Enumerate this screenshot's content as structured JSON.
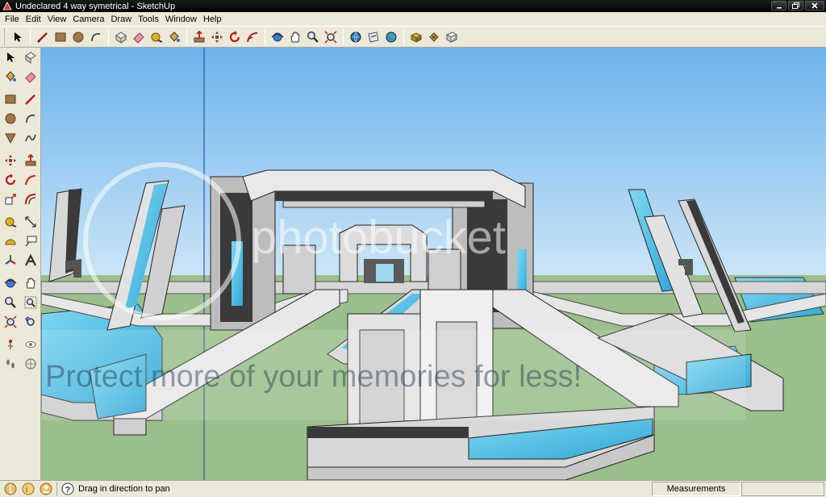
{
  "window": {
    "title": "Undeclared 4 way symetrical - SketchUp"
  },
  "menu": {
    "items": [
      {
        "label": "File"
      },
      {
        "label": "Edit"
      },
      {
        "label": "View"
      },
      {
        "label": "Camera"
      },
      {
        "label": "Draw"
      },
      {
        "label": "Tools"
      },
      {
        "label": "Window"
      },
      {
        "label": "Help"
      }
    ]
  },
  "toolbar_top": {
    "tools": [
      "select-icon",
      "line-icon",
      "rectangle-icon",
      "circle-icon",
      "arc-icon",
      "make-component-icon",
      "eraser-icon",
      "tape-measure-icon",
      "paint-bucket-icon",
      "push-pull-icon",
      "move-icon",
      "rotate-icon",
      "follow-me-icon",
      "orbit-icon",
      "pan-icon",
      "zoom-icon",
      "zoom-extents-icon",
      "get-models-icon",
      "share-model-icon",
      "google-earth-icon",
      "components-icon",
      "materials-icon",
      "styles-icon"
    ]
  },
  "toolbar_left": {
    "tools": [
      "select-icon",
      "make-component-icon",
      "paint-bucket-icon",
      "eraser-icon",
      "rectangle-icon",
      "line-icon",
      "circle-icon",
      "arc-icon",
      "polygon-icon",
      "freehand-icon",
      "move-icon",
      "push-pull-icon",
      "rotate-icon",
      "follow-me-icon",
      "scale-icon",
      "offset-icon",
      "tape-measure-icon",
      "dimension-icon",
      "protractor-icon",
      "text-icon",
      "axes-icon",
      "3d-text-icon",
      "orbit-icon",
      "pan-icon",
      "zoom-icon",
      "zoom-window-icon",
      "zoom-extents-icon",
      "previous-view-icon",
      "position-camera-icon",
      "look-around-icon",
      "walk-icon",
      "section-plane-icon"
    ]
  },
  "viewport": {
    "watermark": "Protect more of your memories for less!",
    "watermark_logo": "photobucket",
    "colors": {
      "sky_top": "#6fb6ee",
      "sky_bottom": "#c7e3f7",
      "ground": "#9bbf8a",
      "glass": "#4fc3e8",
      "structure": "#dcdcdc",
      "dark": "#3a3a3a"
    }
  },
  "statusbar": {
    "hint": "Drag in direction to pan",
    "measurements_label": "Measurements",
    "measurements_value": ""
  }
}
